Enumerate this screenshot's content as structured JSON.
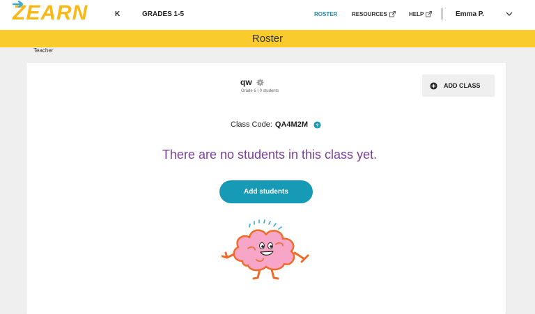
{
  "app": {
    "logo_text": "ZEARN"
  },
  "nav": {
    "k": "K",
    "grades": "GRADES 1-5",
    "roster": "ROSTER",
    "resources": "RESOURCES",
    "help": "HELP",
    "user": "Emma P."
  },
  "banner": {
    "title": "Roster"
  },
  "teacher_label": "Teacher",
  "class": {
    "name": "qw",
    "grade": "Grade 6",
    "students": "0 students",
    "code_label": "Class Code:",
    "code_value": "QA4M2M"
  },
  "buttons": {
    "add_class": "ADD CLASS",
    "add_students": "Add students"
  },
  "empty_message": "There are no students in this class yet.",
  "colors": {
    "brand_yellow": "#f9cb2c",
    "logo_yellow": "#f8b818",
    "accent_teal": "#169ab5",
    "link_blue": "#1e88a8",
    "message_purple": "#7b3f9a"
  }
}
